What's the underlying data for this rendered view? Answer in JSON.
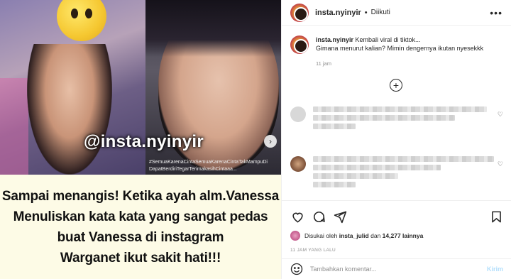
{
  "media": {
    "watermark": "@insta.nyinyir",
    "hashtag_overlay": "#SemuaKarenaCintaSemuaKarenaCintaTakMampuDi DapatBerdiriTegarTerimakasihCintaaa...",
    "caption_lines": [
      "Sampai menangis! Ketika ayah alm.Vanessa",
      "Menuliskan kata kata yang sangat pedas",
      "buat Vanessa di instagram",
      "Warganet ikut sakit hati!!!"
    ],
    "next_icon": "chevron-right-icon"
  },
  "header": {
    "username": "insta.nyinyir",
    "separator": "•",
    "follow_status": "Diikuti",
    "more_icon": "ellipsis-icon"
  },
  "post": {
    "username": "insta.nyinyir",
    "caption_line1": "Kembali viral di tiktok...",
    "caption_line2": "Gimana menurut kalian? Mimin dengernya ikutan nyesekkk",
    "time": "11 jam"
  },
  "likes": {
    "prefix": "Disukai oleh",
    "liker": "insta_julid",
    "connector": "dan",
    "count": "14,277 lainnya"
  },
  "posted_ago": "11 JAM YANG LALU",
  "comment_box": {
    "placeholder": "Tambahkan komentar...",
    "send_label": "Kirim"
  },
  "colors": {
    "caption_bg": "#fdfbe6",
    "send_disabled": "#b2dffc"
  }
}
